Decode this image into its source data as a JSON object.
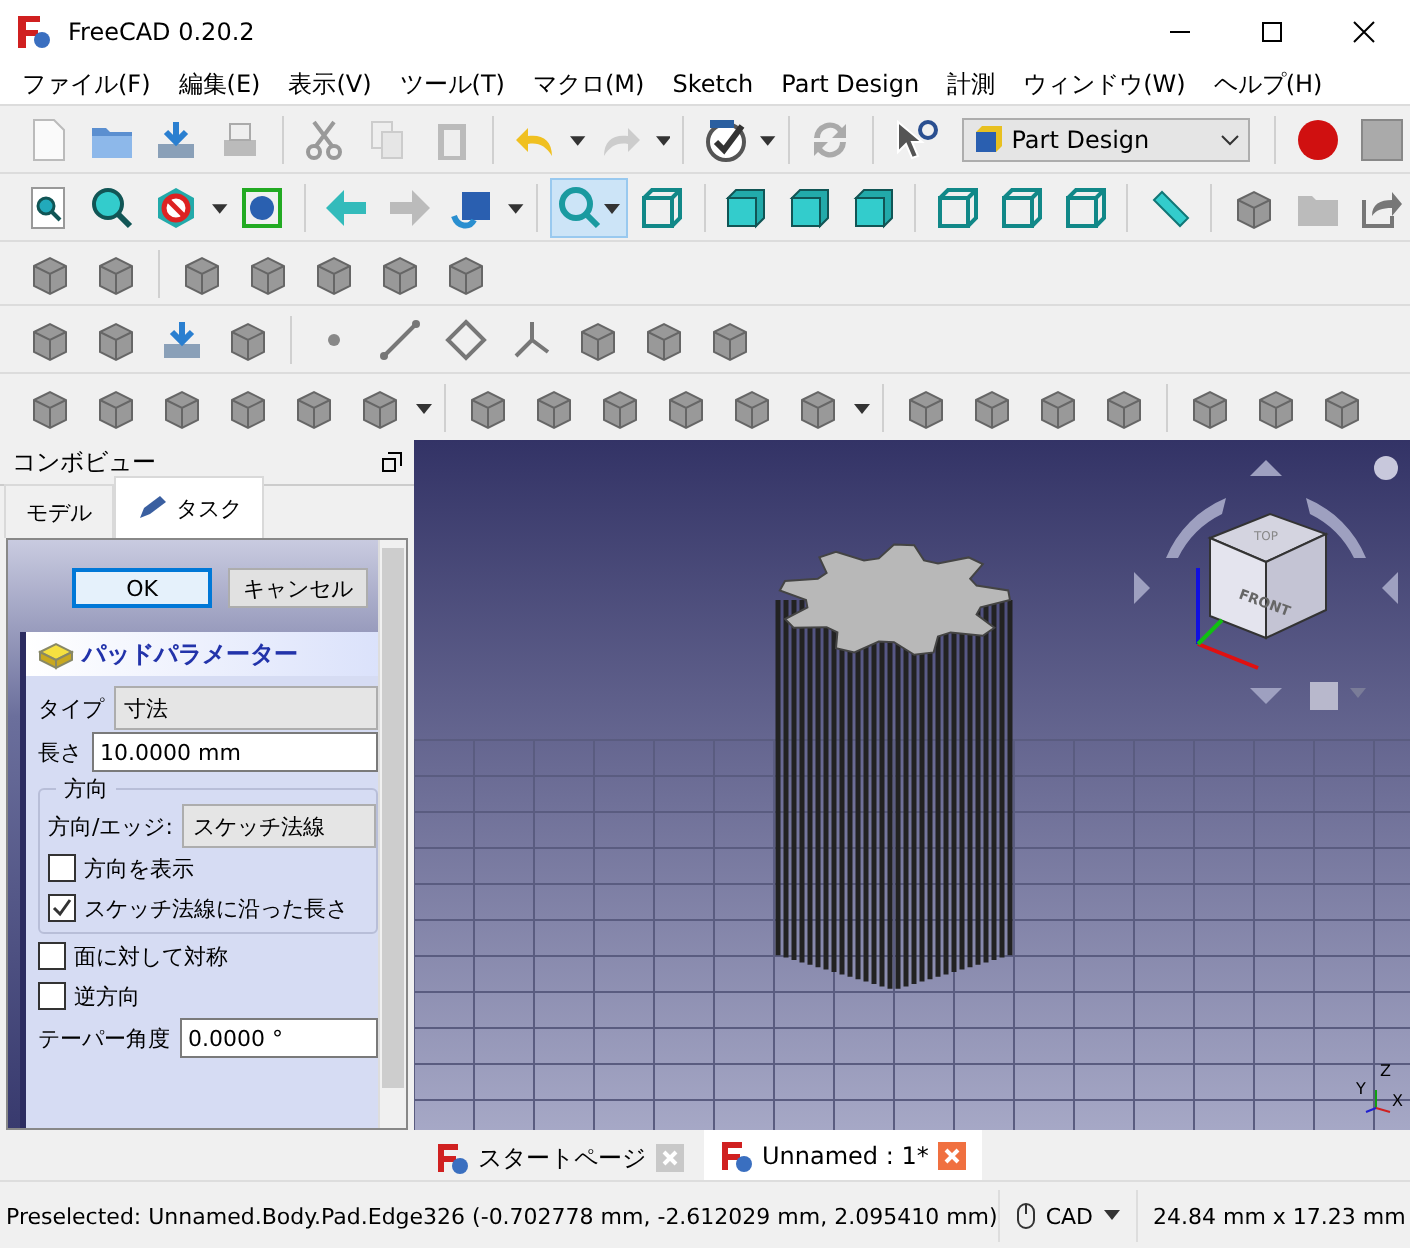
{
  "window": {
    "title": "FreeCAD 0.20.2"
  },
  "menu": [
    "ファイル(F)",
    "編集(E)",
    "表示(V)",
    "ツール(T)",
    "マクロ(M)",
    "Sketch",
    "Part Design",
    "計測",
    "ウィンドウ(W)",
    "ヘルプ(H)"
  ],
  "workbench": {
    "value": "Part Design"
  },
  "combo_view": {
    "title": "コンボビュー",
    "tabs": [
      {
        "label": "モデル",
        "selected": false
      },
      {
        "label": "タスク",
        "selected": true
      }
    ],
    "buttons": [
      {
        "label": "OK",
        "focused": true
      },
      {
        "label": "キャンセル",
        "focused": false
      }
    ],
    "pad": {
      "title": "パッドパラメーター",
      "type_label": "タイプ",
      "type_value": "寸法",
      "length_label": "長さ",
      "length_value": "10.0000 mm",
      "direction": {
        "title": "方向",
        "edge_label": "方向/エッジ:",
        "edge_value": "スケッチ法線",
        "checks": [
          {
            "label": "方向を表示",
            "checked": false
          },
          {
            "label": "スケッチ法線に沿った長さ",
            "checked": true
          }
        ]
      },
      "checks": [
        {
          "label": "面に対して対称",
          "checked": false
        },
        {
          "label": "逆方向",
          "checked": false
        }
      ],
      "taper_label": "テーパー角度",
      "taper_value": "0.0000 °"
    }
  },
  "nav_cube": {
    "top": "TOP",
    "front": "FRONT"
  },
  "axes": [
    "Z",
    "Y",
    "X"
  ],
  "doc_tabs": [
    {
      "label": "スタートページ",
      "selected": false
    },
    {
      "label": "Unnamed : 1*",
      "selected": true
    }
  ],
  "status_bar": {
    "message": "Preselected: Unnamed.Body.Pad.Edge326 (-0.702778 mm, -2.612029 mm, 2.095410 mm)",
    "nav_style": "CAD",
    "dimensions": "24.84 mm x 17.23 mm"
  }
}
